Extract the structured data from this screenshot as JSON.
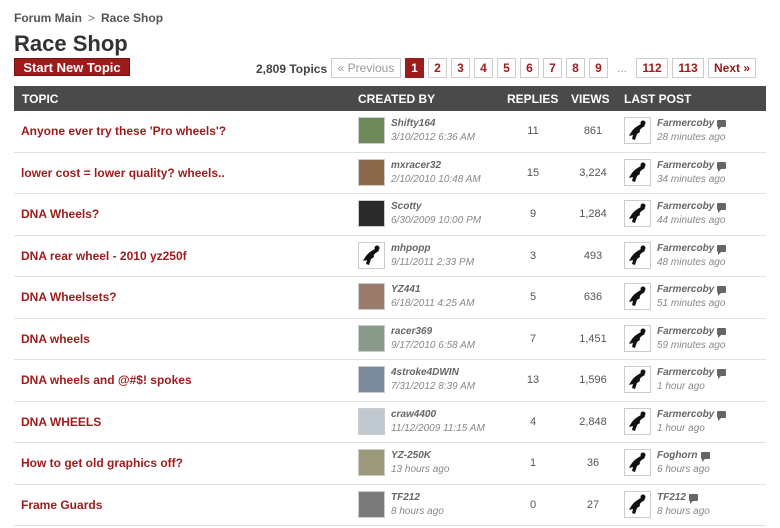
{
  "breadcrumb": {
    "root": "Forum Main",
    "separator": ">",
    "current": "Race Shop"
  },
  "page_title": "Race Shop",
  "new_topic_label": "Start New Topic",
  "topic_count": "2,809 Topics",
  "pager": {
    "prev": "« Previous",
    "pages": [
      "1",
      "2",
      "3",
      "4",
      "5",
      "6",
      "7",
      "8",
      "9"
    ],
    "ellipsis": "...",
    "tail": [
      "112",
      "113"
    ],
    "next": "Next »",
    "active": "1"
  },
  "columns": {
    "topic": "TOPIC",
    "created_by": "CREATED BY",
    "replies": "REPLIES",
    "views": "VIEWS",
    "last_post": "LAST POST"
  },
  "rows": [
    {
      "title": "Anyone ever try these 'Pro wheels'?",
      "author": "Shifty164",
      "created": "3/10/2012 6:36 AM",
      "replies": "11",
      "views": "861",
      "last_by": "Farmercoby",
      "last_time": "28 minutes ago"
    },
    {
      "title": "lower cost = lower quality? wheels..",
      "author": "mxracer32",
      "created": "2/10/2010 10:48 AM",
      "replies": "15",
      "views": "3,224",
      "last_by": "Farmercoby",
      "last_time": "34 minutes ago"
    },
    {
      "title": "DNA Wheels?",
      "author": "Scotty",
      "created": "6/30/2009 10:00 PM",
      "replies": "9",
      "views": "1,284",
      "last_by": "Farmercoby",
      "last_time": "44 minutes ago"
    },
    {
      "title": "DNA rear wheel - 2010 yz250f",
      "author": "mhpopp",
      "created": "9/11/2011 2:33 PM",
      "replies": "3",
      "views": "493",
      "last_by": "Farmercoby",
      "last_time": "48 minutes ago"
    },
    {
      "title": "DNA Wheelsets?",
      "author": "YZ441",
      "created": "6/18/2011 4:25 AM",
      "replies": "5",
      "views": "636",
      "last_by": "Farmercoby",
      "last_time": "51 minutes ago"
    },
    {
      "title": "DNA wheels",
      "author": "racer369",
      "created": "9/17/2010 6:58 AM",
      "replies": "7",
      "views": "1,451",
      "last_by": "Farmercoby",
      "last_time": "59 minutes ago"
    },
    {
      "title": "DNA wheels and @#$! spokes",
      "author": "4stroke4DWIN",
      "created": "7/31/2012 8:39 AM",
      "replies": "13",
      "views": "1,596",
      "last_by": "Farmercoby",
      "last_time": "1 hour ago"
    },
    {
      "title": "DNA WHEELS",
      "author": "craw4400",
      "created": "11/12/2009 11:15 AM",
      "replies": "4",
      "views": "2,848",
      "last_by": "Farmercoby",
      "last_time": "1 hour ago"
    },
    {
      "title": "How to get old graphics off?",
      "author": "YZ-250K",
      "created": "13 hours ago",
      "replies": "1",
      "views": "36",
      "last_by": "Foghorn",
      "last_time": "6 hours ago"
    },
    {
      "title": "Frame Guards",
      "author": "TF212",
      "created": "8 hours ago",
      "replies": "0",
      "views": "27",
      "last_by": "TF212",
      "last_time": "8 hours ago"
    }
  ],
  "avatar_colors": [
    "#6e8a5a",
    "#8a6a4a",
    "#2a2a2a",
    "#ffffff",
    "#9a7a6a",
    "#8a9a8a",
    "#7a8a9a",
    "#c0c8d0",
    "#9a9a7a",
    "#7a7a7a"
  ],
  "icons": {
    "separator": "chevron-right-icon",
    "last_post": "comment-bubble-icon",
    "rider_avatar": "motocross-rider-icon"
  }
}
